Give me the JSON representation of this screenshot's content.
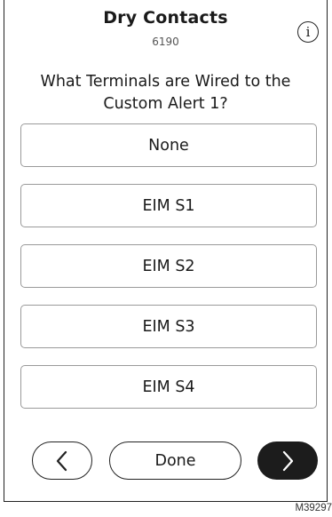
{
  "header": {
    "title": "Dry Contacts",
    "code": "6190",
    "info_icon_glyph": "i"
  },
  "question": "What Terminals are Wired to the Custom Alert 1?",
  "options": [
    {
      "label": "None"
    },
    {
      "label": "EIM S1"
    },
    {
      "label": "EIM S2"
    },
    {
      "label": "EIM S3"
    },
    {
      "label": "EIM S4"
    }
  ],
  "footer": {
    "back_icon": "chevron-left-icon",
    "done_label": "Done",
    "next_icon": "chevron-right-icon"
  },
  "figure_id": "M39297",
  "colors": {
    "next_button_bg": "#1c1c1c",
    "border": "#9a9a9a"
  }
}
